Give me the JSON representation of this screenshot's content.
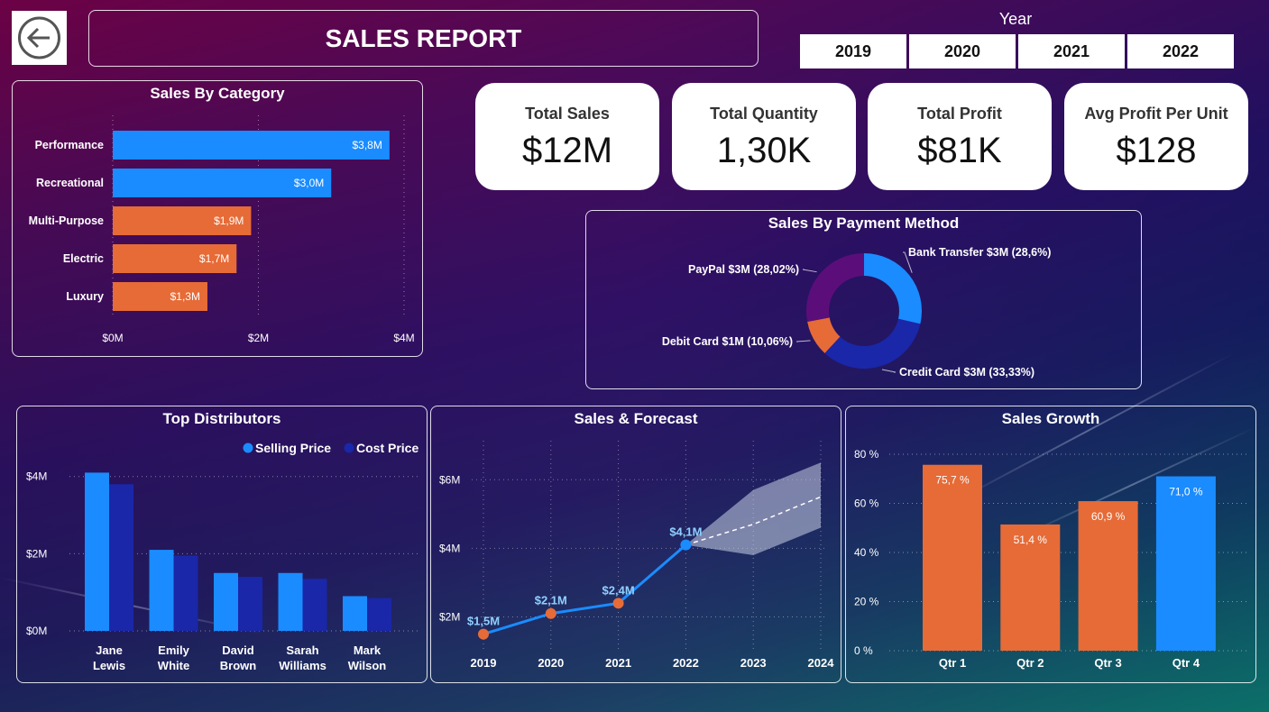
{
  "header": {
    "title": "SALES REPORT",
    "year_label": "Year",
    "years": [
      "2019",
      "2020",
      "2021",
      "2022"
    ]
  },
  "kpis": [
    {
      "label": "Total Sales",
      "value": "$12M"
    },
    {
      "label": "Total Quantity",
      "value": "1,30K"
    },
    {
      "label": "Total Profit",
      "value": "$81K"
    },
    {
      "label": "Avg Profit Per Unit",
      "value": "$128"
    }
  ],
  "panels": {
    "category": "Sales By Category",
    "payment": "Sales By Payment Method",
    "distributors": "Top Distributors",
    "forecast": "Sales & Forecast",
    "growth": "Sales Growth"
  },
  "colors": {
    "blue": "#1a8cff",
    "orange": "#e66b37",
    "navy": "#1a27a8",
    "purple": "#5b0e7a"
  },
  "chart_data": [
    {
      "id": "category",
      "type": "bar",
      "orientation": "horizontal",
      "title": "Sales By Category",
      "categories": [
        "Performance",
        "Recreational",
        "Multi-Purpose",
        "Electric",
        "Luxury"
      ],
      "values": [
        3.8,
        3.0,
        1.9,
        1.7,
        1.3
      ],
      "labels": [
        "$3,8M",
        "$3,0M",
        "$1,9M",
        "$1,7M",
        "$1,3M"
      ],
      "bar_colors": [
        "#1a8cff",
        "#1a8cff",
        "#e66b37",
        "#e66b37",
        "#e66b37"
      ],
      "x_ticks": [
        0,
        2,
        4
      ],
      "x_tick_labels": [
        "$0M",
        "$2M",
        "$4M"
      ],
      "xlim": [
        0,
        4
      ]
    },
    {
      "id": "payment",
      "type": "pie",
      "style": "donut",
      "title": "Sales By Payment Method",
      "slices": [
        {
          "name": "Bank Transfer",
          "value": 28.6,
          "label": "Bank Transfer $3M (28,6%)",
          "color": "#1a8cff"
        },
        {
          "name": "Credit Card",
          "value": 33.33,
          "label": "Credit Card $3M (33,33%)",
          "color": "#1a27a8"
        },
        {
          "name": "Debit Card",
          "value": 10.06,
          "label": "Debit Card $1M (10,06%)",
          "color": "#e66b37"
        },
        {
          "name": "PayPal",
          "value": 28.02,
          "label": "PayPal $3M (28,02%)",
          "color": "#5b0e7a"
        }
      ]
    },
    {
      "id": "distributors",
      "type": "bar",
      "title": "Top Distributors",
      "categories": [
        "Jane Lewis",
        "Emily White",
        "David Brown",
        "Sarah Williams",
        "Mark Wilson"
      ],
      "category_lines": [
        [
          "Jane",
          "Lewis"
        ],
        [
          "Emily",
          "White"
        ],
        [
          "David",
          "Brown"
        ],
        [
          "Sarah",
          "Williams"
        ],
        [
          "Mark",
          "Wilson"
        ]
      ],
      "series": [
        {
          "name": "Selling Price",
          "values": [
            4.1,
            2.1,
            1.5,
            1.5,
            0.9
          ],
          "color": "#1a8cff"
        },
        {
          "name": "Cost Price",
          "values": [
            3.8,
            1.95,
            1.4,
            1.35,
            0.85
          ],
          "color": "#1a27a8"
        }
      ],
      "y_ticks": [
        0,
        2,
        4
      ],
      "y_tick_labels": [
        "$0M",
        "$2M",
        "$4M"
      ],
      "ylim": [
        0,
        4.6
      ],
      "legend": "top-right"
    },
    {
      "id": "forecast",
      "type": "line",
      "title": "Sales & Forecast",
      "x": [
        "2019",
        "2020",
        "2021",
        "2022",
        "2023",
        "2024"
      ],
      "actual": [
        1.5,
        2.1,
        2.4,
        4.1
      ],
      "actual_labels": [
        "$1,5M",
        "$2,1M",
        "$2,4M",
        "$4,1M"
      ],
      "forecast": [
        null,
        null,
        null,
        4.1,
        4.7,
        5.5
      ],
      "forecast_upper": [
        null,
        null,
        null,
        4.1,
        5.7,
        6.5
      ],
      "forecast_lower": [
        null,
        null,
        null,
        4.1,
        3.8,
        4.6
      ],
      "y_ticks": [
        2,
        4,
        6
      ],
      "y_tick_labels": [
        "$2M",
        "$4M",
        "$6M"
      ],
      "ylim": [
        1.2,
        6.9
      ]
    },
    {
      "id": "growth",
      "type": "bar",
      "title": "Sales Growth",
      "categories": [
        "Qtr 1",
        "Qtr 2",
        "Qtr 3",
        "Qtr 4"
      ],
      "values": [
        75.7,
        51.4,
        60.9,
        71.0
      ],
      "labels": [
        "75,7 %",
        "51,4 %",
        "60,9 %",
        "71,0 %"
      ],
      "bar_colors": [
        "#e66b37",
        "#e66b37",
        "#e66b37",
        "#1a8cff"
      ],
      "y_ticks": [
        0,
        20,
        40,
        60,
        80
      ],
      "y_tick_labels": [
        "0 %",
        "20 %",
        "40 %",
        "60 %",
        "80 %"
      ],
      "ylim": [
        0,
        80
      ]
    }
  ]
}
